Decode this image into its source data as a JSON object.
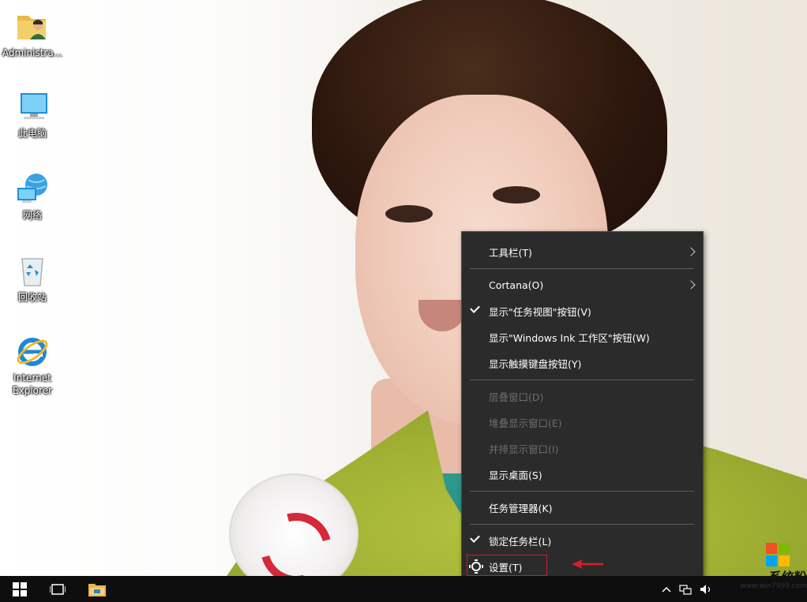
{
  "desktop": {
    "icons": [
      {
        "label": "Administra..."
      },
      {
        "label": "此电脑"
      },
      {
        "label": "网络"
      },
      {
        "label": "回收站"
      },
      {
        "label": "Internet\nExplorer"
      }
    ]
  },
  "context_menu": {
    "items": [
      {
        "label": "工具栏(T)",
        "submenu": true
      },
      {
        "label": "Cortana(O)",
        "submenu": true
      },
      {
        "label": "显示\"任务视图\"按钮(V)",
        "checked": true
      },
      {
        "label": "显示\"Windows Ink 工作区\"按钮(W)"
      },
      {
        "label": "显示触摸键盘按钮(Y)"
      },
      {
        "label": "层叠窗口(D)",
        "disabled": true
      },
      {
        "label": "堆叠显示窗口(E)",
        "disabled": true
      },
      {
        "label": "并排显示窗口(I)",
        "disabled": true
      },
      {
        "label": "显示桌面(S)"
      },
      {
        "label": "任务管理器(K)"
      },
      {
        "label": "锁定任务栏(L)",
        "checked": true
      },
      {
        "label": "设置(T)",
        "icon": "gear-icon",
        "highlighted": true
      }
    ]
  },
  "taskbar": {
    "start_icon": "windows-logo-icon",
    "task_view_icon": "task-view-icon",
    "explorer_icon": "file-explorer-icon",
    "tray_icons": [
      "chevron-up-icon",
      "network-icon",
      "volume-icon"
    ]
  },
  "watermark": {
    "text": "系统粉",
    "url": "www.win7999.com"
  },
  "colors": {
    "menu_bg": "#2b2b2b",
    "taskbar_bg": "#0e0e0e",
    "annotation_red": "#c8202a"
  }
}
